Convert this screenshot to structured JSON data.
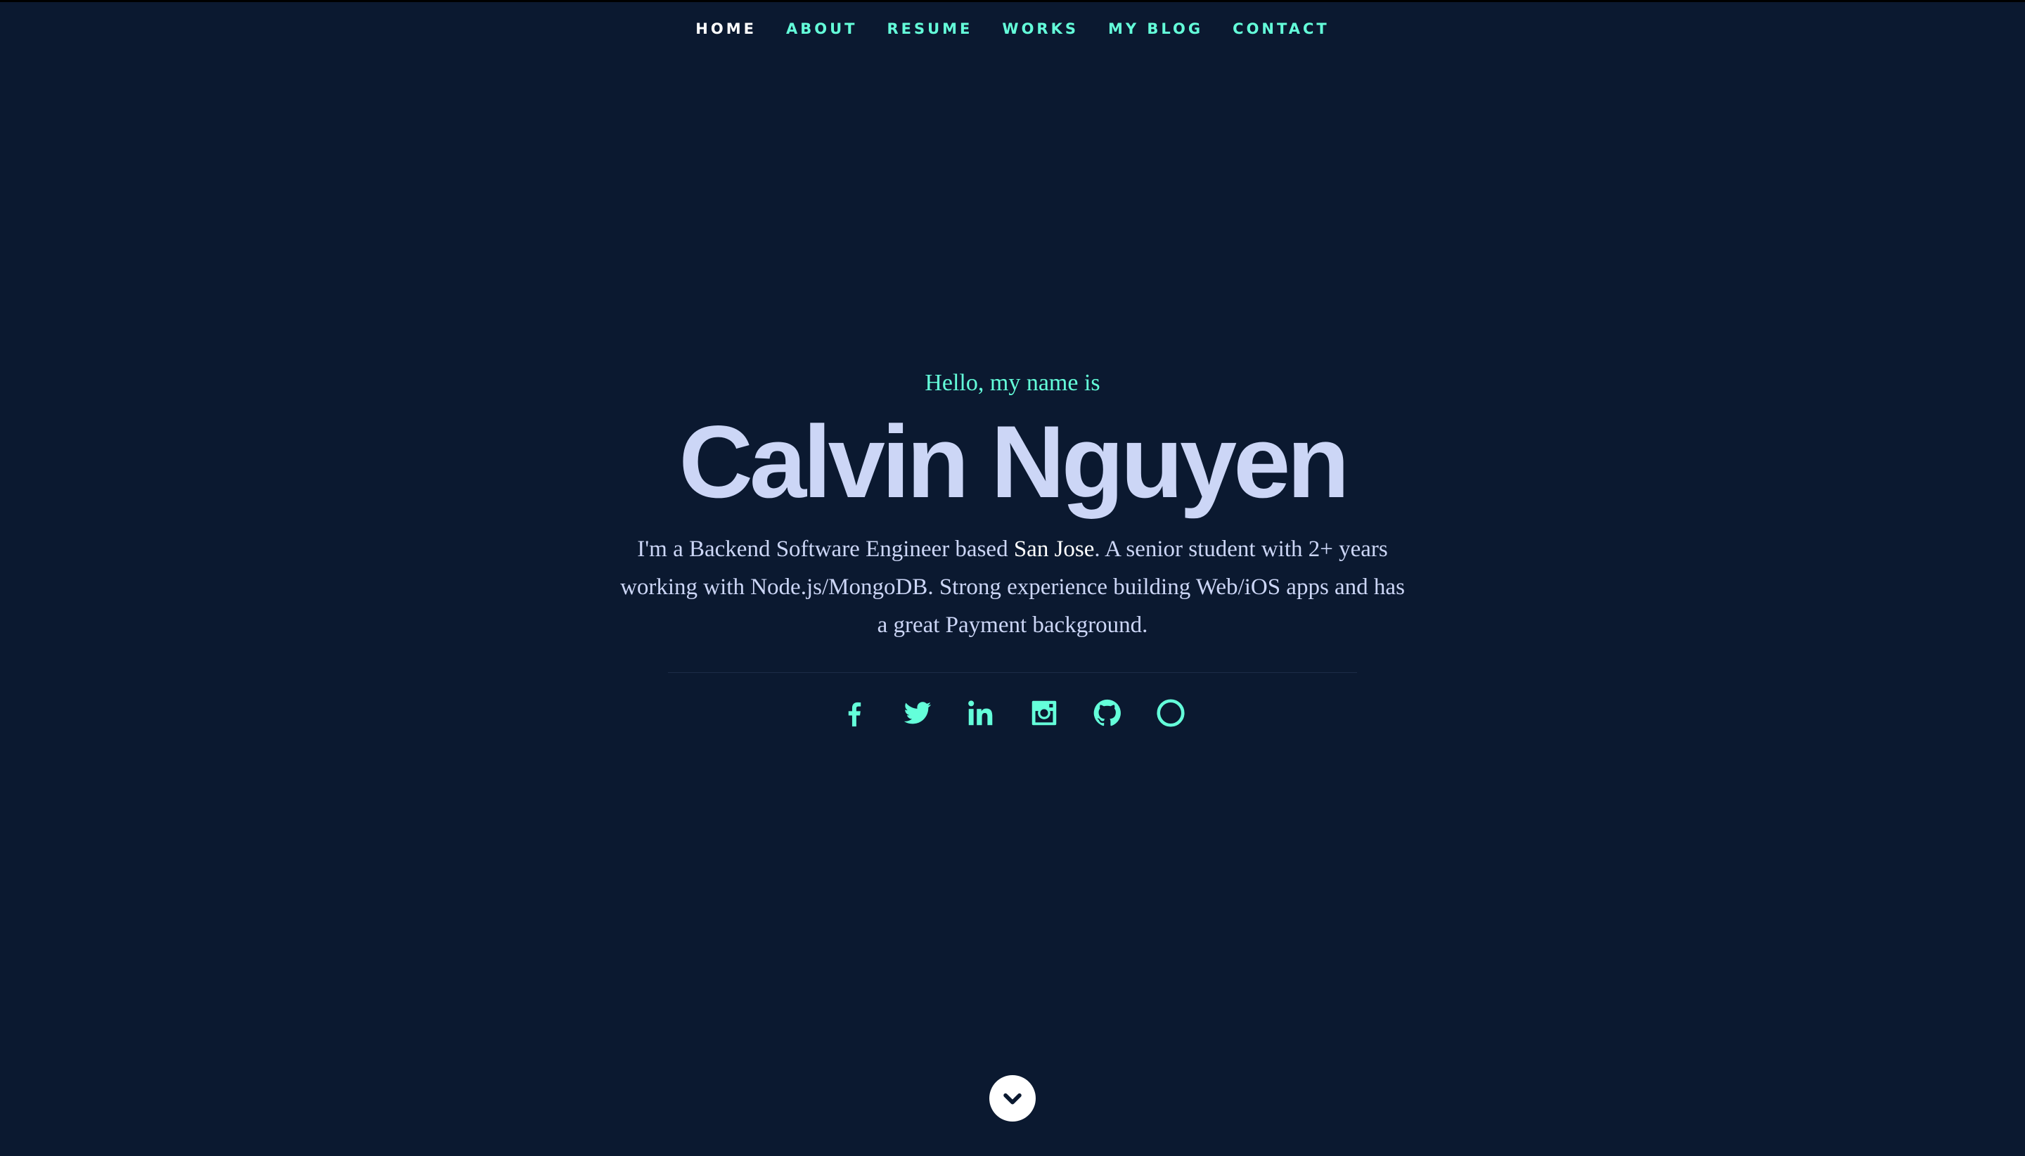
{
  "nav": {
    "items": [
      {
        "label": "HOME",
        "active": true
      },
      {
        "label": "ABOUT",
        "active": false
      },
      {
        "label": "RESUME",
        "active": false
      },
      {
        "label": "WORKS",
        "active": false
      },
      {
        "label": "MY BLOG",
        "active": false
      },
      {
        "label": "CONTACT",
        "active": false
      }
    ]
  },
  "hero": {
    "greeting": "Hello, my name is",
    "name": "Calvin Nguyen",
    "bio_part1": "I'm a Backend Software Engineer based ",
    "bio_highlight": "San Jose",
    "bio_part2": ". A senior student with 2+ years working with Node.js/MongoDB. Strong experience building Web/iOS apps and has a great Payment background."
  },
  "social": [
    {
      "icon": "facebook-icon"
    },
    {
      "icon": "twitter-icon"
    },
    {
      "icon": "linkedin-icon"
    },
    {
      "icon": "instagram-icon"
    },
    {
      "icon": "github-icon"
    },
    {
      "icon": "circle-icon"
    }
  ],
  "colors": {
    "background": "#0b1930",
    "accent": "#64ffda",
    "text": "#ccd6f6",
    "white": "#ffffff"
  },
  "scroll_down": {
    "icon": "chevron-down-icon"
  }
}
